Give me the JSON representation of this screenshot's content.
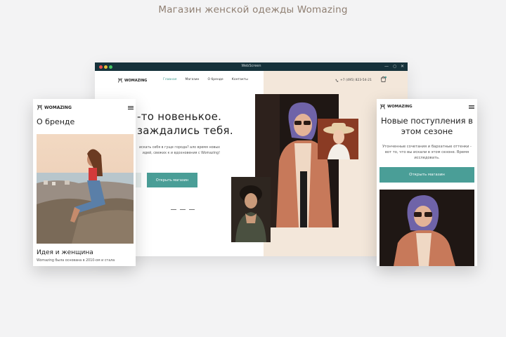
{
  "page_title": "Магазин женской одежды Womazing",
  "brand": "WOMAZING",
  "desktop": {
    "window_title": "WebScreen",
    "window_controls": [
      "—",
      "○",
      "✕"
    ],
    "nav": [
      "Главная",
      "Магазин",
      "О бренде",
      "Контакты"
    ],
    "phone": "+7 (495) 823-54-21",
    "hero_title_line1": "-то новенькое.",
    "hero_title_line2": "заждались тебя.",
    "hero_sub": "искать себя в гуще города? ало время новых идей, свежих к и вдохновения с Womazing!",
    "shop_button": "Открыть магазин",
    "prev_button": "↓"
  },
  "mobile_left": {
    "section_title": "О бренде",
    "subtitle": "Идея и женщина",
    "text": "Womazing была основана в 2010-ом и стала"
  },
  "mobile_right": {
    "title": "Новые поступления в этом сезоне",
    "text": "Утонченные сочетания и бархатные оттенки - вот то, что вы искали в этом сезоне. Время исследовать.",
    "shop_button": "Открыть магазин"
  },
  "colors": {
    "accent": "#4a9e97",
    "titlebar": "#16323b",
    "hero_bg": "#f3e7da"
  }
}
